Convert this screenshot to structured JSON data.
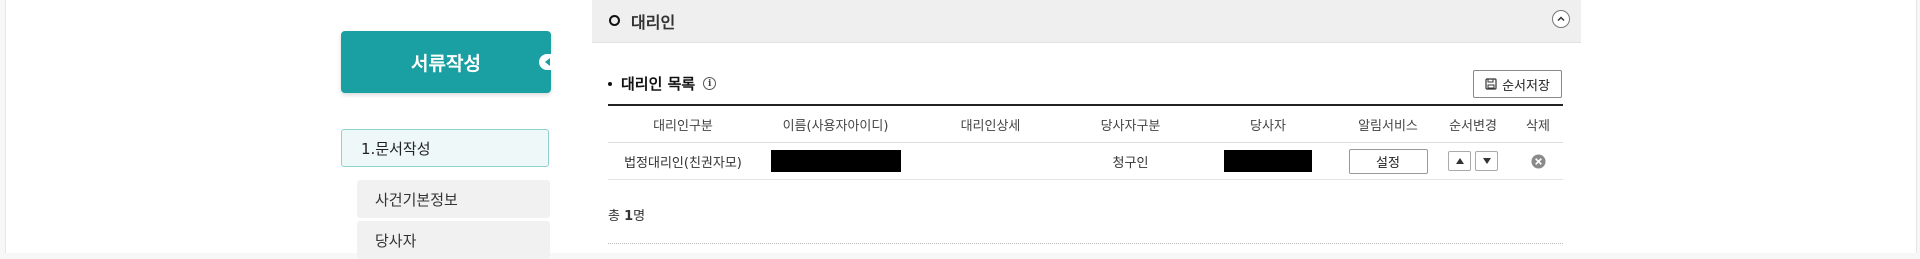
{
  "sidebar": {
    "title": "서류작성",
    "step": "1.문서작성",
    "items": [
      {
        "label": "사건기본정보"
      },
      {
        "label": "당사자"
      }
    ]
  },
  "section": {
    "title": "대리인",
    "collapse_icon": "chevron-up-icon"
  },
  "list": {
    "heading": "대리인 목록",
    "info_glyph": "i",
    "save_order_label": "순서저장",
    "save_icon": "save-icon"
  },
  "table": {
    "headers": {
      "type": "대리인구분",
      "name": "이름(사용자아이디)",
      "detail": "대리인상세",
      "party_type": "당사자구분",
      "party": "당사자",
      "notify": "알림서비스",
      "order": "순서변경",
      "delete": "삭제"
    },
    "rows": [
      {
        "type": "법정대리인(친권자모)",
        "name_redacted": true,
        "detail": "",
        "party_type": "청구인",
        "party_redacted": true,
        "notify_button": "설정"
      }
    ]
  },
  "total": {
    "prefix": "총",
    "count": "1",
    "unit": "명"
  }
}
